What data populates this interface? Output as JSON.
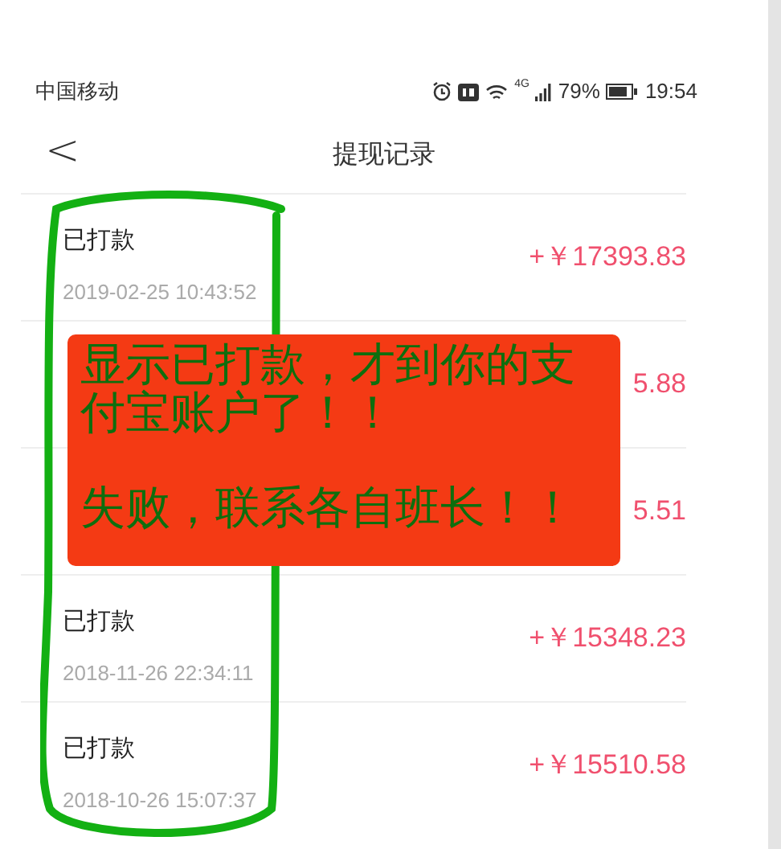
{
  "status_bar": {
    "carrier": "中国移动",
    "network": "4G",
    "battery": "79%",
    "time": "19:54"
  },
  "nav": {
    "back": "<",
    "title": "提现记录"
  },
  "rows": [
    {
      "status": "已打款",
      "date": "2019-02-25 10:43:52",
      "amount": "+￥17393.83"
    },
    {
      "amount": "5.88"
    },
    {
      "amount": "5.51"
    },
    {
      "status": "已打款",
      "date": "2018-11-26 22:34:11",
      "amount": "+￥15348.23"
    },
    {
      "status": "已打款",
      "date": "2018-10-26 15:07:37",
      "amount": "+￥15510.58"
    }
  ],
  "annotation": {
    "lines": [
      "显示已打款，才到你的支付宝账户了！！",
      "失败，联系各自班长！！"
    ]
  }
}
